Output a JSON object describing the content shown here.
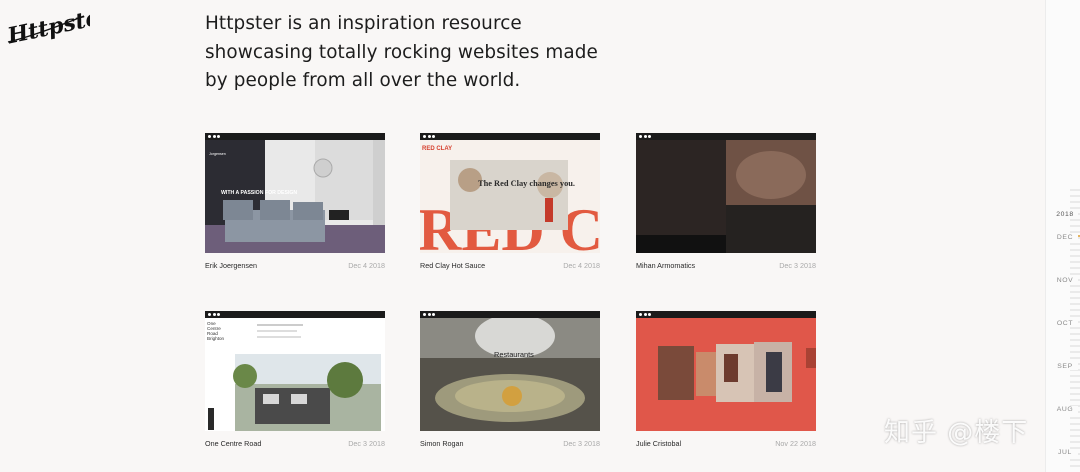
{
  "brand": {
    "logo_text": "Httpster"
  },
  "intro": {
    "lines": [
      "Httpster is an inspiration resource",
      "showcasing totally rocking websites made",
      "by people from all over the world."
    ]
  },
  "cards": [
    {
      "name": "Erik Joergensen",
      "date": "Dec 4 2018",
      "thumb_text": "WITH A PASSION FOR DESIGN",
      "thumb_brand": "Jorgensen"
    },
    {
      "name": "Red Clay Hot Sauce",
      "date": "Dec 4 2018",
      "thumb_text": "The Red Clay changes you.",
      "thumb_brand": "RED CLAY"
    },
    {
      "name": "Mihan Armomatics",
      "date": "Dec 3 2018"
    },
    {
      "name": "One Centre Road",
      "date": "Dec 3 2018",
      "thumb_text": "One Centre Road Brighton"
    },
    {
      "name": "Simon Rogan",
      "date": "Dec 3 2018",
      "thumb_text": "Restaurants"
    },
    {
      "name": "Julie Cristobal",
      "date": "Nov 22 2018"
    }
  ],
  "timeline": {
    "year": "2018",
    "months": [
      "DEC",
      "NOV",
      "OCT",
      "SEP",
      "AUG",
      "JUL"
    ],
    "accent": "#e2a23a"
  },
  "watermark": {
    "text": "知乎 @楼下"
  }
}
